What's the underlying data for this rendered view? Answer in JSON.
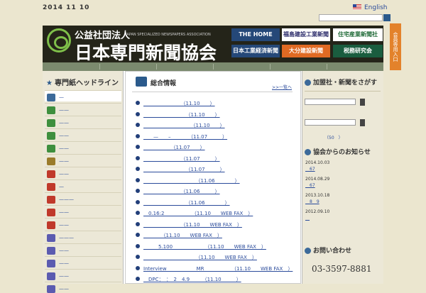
{
  "date": "2014 11 10",
  "lang_link": "English",
  "header": {
    "small": "公益社団法人",
    "big": "日本専門新聞協会",
    "english": "JAPAN SPECIALIZED NEWSPAPERS ASSOCIATION"
  },
  "banners": [
    "THE HOME LIVING",
    "福島建設工業新聞社",
    "住宅産業新聞社",
    "日本工業経済新聞社",
    "大分建設新聞",
    "税務研究会"
  ],
  "member_entry": "会員専用入口",
  "left": {
    "title": "専門紙ヘッドライン",
    "cats": [
      {
        "label": "—",
        "color": "#3c6a9a"
      },
      {
        "label": "——",
        "color": "#3e8f3e"
      },
      {
        "label": "——",
        "color": "#3e8f3e"
      },
      {
        "label": "——",
        "color": "#3e8f3e"
      },
      {
        "label": "——",
        "color": "#3e8f3e"
      },
      {
        "label": "——",
        "color": "#9a7b2a"
      },
      {
        "label": "——",
        "color": "#c0392b"
      },
      {
        "label": "—",
        "color": "#c0392b"
      },
      {
        "label": "———",
        "color": "#c0392b"
      },
      {
        "label": "——",
        "color": "#c0392b"
      },
      {
        "label": "——",
        "color": "#c0392b"
      },
      {
        "label": "———",
        "color": "#5b5bb0"
      },
      {
        "label": "——",
        "color": "#5b5bb0"
      },
      {
        "label": "——",
        "color": "#5b5bb0"
      },
      {
        "label": "——",
        "color": "#5b5bb0"
      },
      {
        "label": "——",
        "color": "#5b5bb0"
      }
    ]
  },
  "center": {
    "title": "総合情報",
    "more": ">>一覧へ",
    "news": [
      "　　　　　　　　（11.10　　）",
      "　　　　　　　　　（11.10　　）",
      "　　　　　　　　　　（11.10　　）",
      "　　—　　–　　　　（11.07　　　）",
      "　　　　　　（11.07　　）",
      "　　　　　　　　（11.07　　　）",
      "　　　　　　　　　（11.07　　　）",
      "　　　　　　　　　　　（11.06　　　　）",
      "　　　　　　　　（11.06　　　）",
      "　　　　　　　　　（11.06　　　　）",
      "　0.16:2　　　　　　（11.10　　WEB FAX　）",
      "　　　　　　　　（11.10　　WEB FAX　）",
      "　　　　（11.10　　WEB FAX　）",
      "　　　5.100　　　　　　　（11.10　　WEB FAX　）",
      "　　　　　　　　　　　（11.10　　WEB FAX　）",
      "Interview　　　　　　MR　　　　　　（11.10　　WEB FAX　）",
      "　DPC：　：　2　4.9　　　（11.10　　　）"
    ]
  },
  "right": {
    "find_title": "加盟社・新聞をさがす",
    "fifty": "（50　）",
    "news_title": "協会からのお知らせ",
    "notices": [
      {
        "date": "2014.10.03",
        "text": "　67"
      },
      {
        "date": "2014.08.29",
        "text": "　67"
      },
      {
        "date": "2013.10.18",
        "text": "　8　9"
      },
      {
        "date": "2012.09.10",
        "text": "　"
      }
    ],
    "contact_title": "お問い合わせ",
    "phone": "03-3597-8881"
  }
}
